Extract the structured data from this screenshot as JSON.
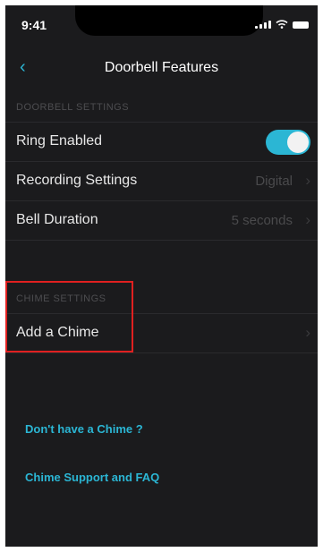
{
  "status_bar": {
    "time": "9:41"
  },
  "nav": {
    "back_icon": "chevron-left",
    "title": "Doorbell Features"
  },
  "doorbell_settings": {
    "header": "DOORBELL SETTINGS",
    "ring_enabled": {
      "label": "Ring Enabled",
      "on": true
    },
    "recording_settings": {
      "label": "Recording Settings",
      "value": "Digital"
    },
    "bell_duration": {
      "label": "Bell Duration",
      "value": "5 seconds"
    }
  },
  "chime_settings": {
    "header": "CHIME SETTINGS",
    "add_chime": {
      "label": "Add a Chime"
    }
  },
  "links": {
    "no_chime": "Don't have a Chime ?",
    "support": "Chime Support and FAQ"
  },
  "colors": {
    "accent": "#2bb6d4",
    "background": "#1b1b1d",
    "highlight": "#e02020"
  }
}
